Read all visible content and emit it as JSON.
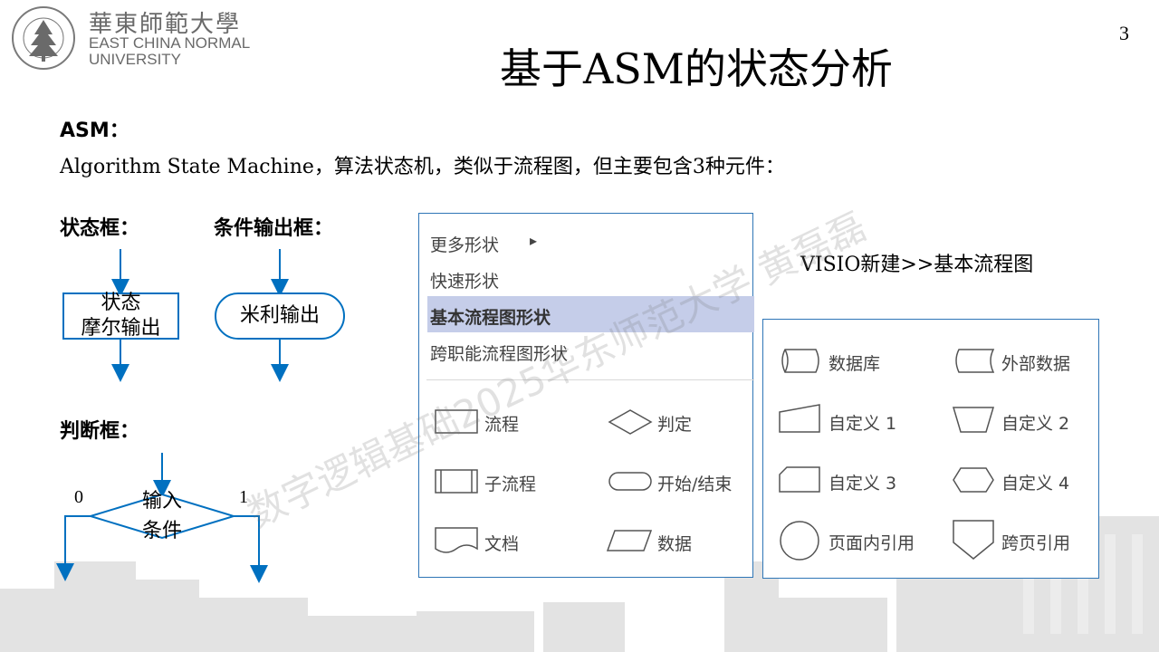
{
  "header": {
    "logo_cn": "華東師範大學",
    "logo_en_line1": "EAST CHINA NORMAL",
    "logo_en_line2": "UNIVERSITY",
    "seal_ring_text": "EAST CHINA NORMAL UNIVERSITY",
    "page_number": "3",
    "title": "基于ASM的状态分析"
  },
  "intro": {
    "heading": "ASM：",
    "description": "Algorithm State Machine，算法状态机，类似于流程图，但主要包含3种元件："
  },
  "diagrams": {
    "state_box_label": "状态框：",
    "state_box_line1": "状态",
    "state_box_line2": "摩尔输出",
    "cond_output_label": "条件输出框：",
    "cond_output_text": "米利输出",
    "decision_label": "判断框：",
    "decision_line1": "输入",
    "decision_line2": "条件",
    "branch_left": "0",
    "branch_right": "1"
  },
  "menu": {
    "items": [
      "更多形状",
      "快速形状",
      "基本流程图形状",
      "跨职能流程图形状"
    ],
    "submenu_arrow": "▸",
    "shapes": [
      "流程",
      "判定",
      "子流程",
      "开始/结束",
      "文档",
      "数据"
    ]
  },
  "visio_note": "VISIO新建>>基本流程图",
  "extra_shapes": [
    "数据库",
    "外部数据",
    "自定义 1",
    "自定义 2",
    "自定义 3",
    "自定义 4",
    "页面内引用",
    "跨页引用"
  ],
  "watermark": "数字逻辑基础2025华东师范大学 黄磊磊",
  "colors": {
    "accent": "#2e75b6",
    "arrow": "#0070c0",
    "menu_highlight": "#c5cde9",
    "logo_gray": "#6a6a6a"
  }
}
